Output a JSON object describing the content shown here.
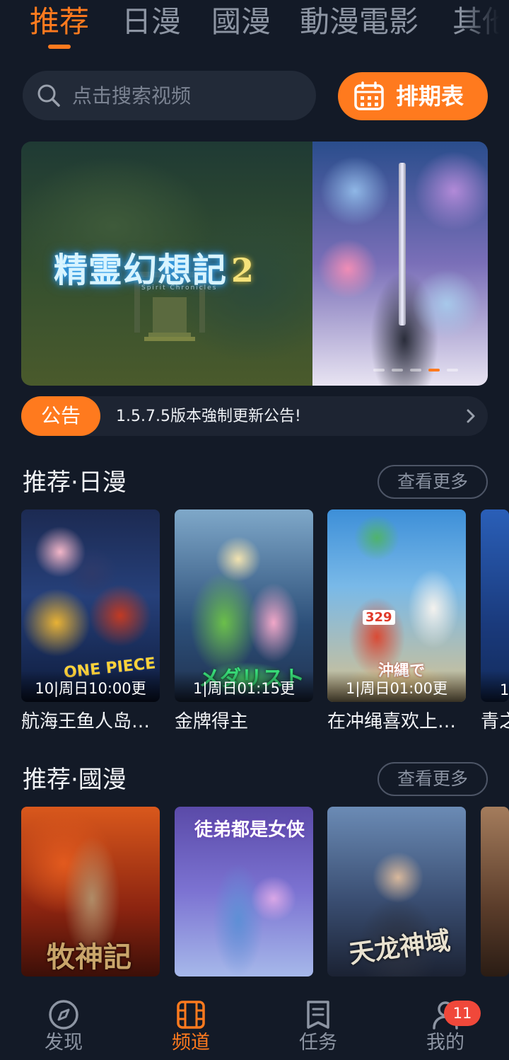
{
  "top_tabs": [
    "推荐",
    "日漫",
    "國漫",
    "動漫電影",
    "其他"
  ],
  "active_tab": "推荐",
  "search": {
    "placeholder": "点击搜索视频"
  },
  "schedule_button": {
    "label": "排期表"
  },
  "banner": {
    "title": "精霊幻想記",
    "title_number": "2",
    "subtitle": "Spirit Chronicles",
    "page_indicator": {
      "count": 5,
      "active": 4
    }
  },
  "notice": {
    "badge": "公告",
    "text": "1.5.7.5版本強制更新公告!"
  },
  "sections": [
    {
      "title": "推荐·日漫",
      "more_label": "查看更多",
      "items": [
        {
          "name": "航海王鱼人岛…",
          "episode": "10|周日10:00更",
          "poster_text": "ONE PIECE"
        },
        {
          "name": "金牌得主",
          "episode": "1|周日01:15更",
          "poster_text": "メダリスト"
        },
        {
          "name": "在冲绳喜欢上…",
          "episode": "1|周日01:00更",
          "poster_text": "沖縄で",
          "poster_number": "329"
        },
        {
          "name": "青之",
          "episode": "1"
        }
      ]
    },
    {
      "title": "推荐·國漫",
      "more_label": "查看更多",
      "items": [
        {
          "poster_text": "牧神記"
        },
        {
          "poster_text": "徒弟都是女侠"
        },
        {
          "poster_text": "天龙神域"
        },
        {
          "poster_text": ""
        }
      ]
    }
  ],
  "bottom_nav": [
    {
      "label": "发现",
      "icon": "compass-icon"
    },
    {
      "label": "频道",
      "icon": "film-icon",
      "active": true
    },
    {
      "label": "任务",
      "icon": "task-icon"
    },
    {
      "label": "我的",
      "icon": "user-icon",
      "badge": "11"
    }
  ],
  "colors": {
    "accent": "#ff7a1e",
    "background": "#131a27",
    "badge": "#f0483a"
  }
}
